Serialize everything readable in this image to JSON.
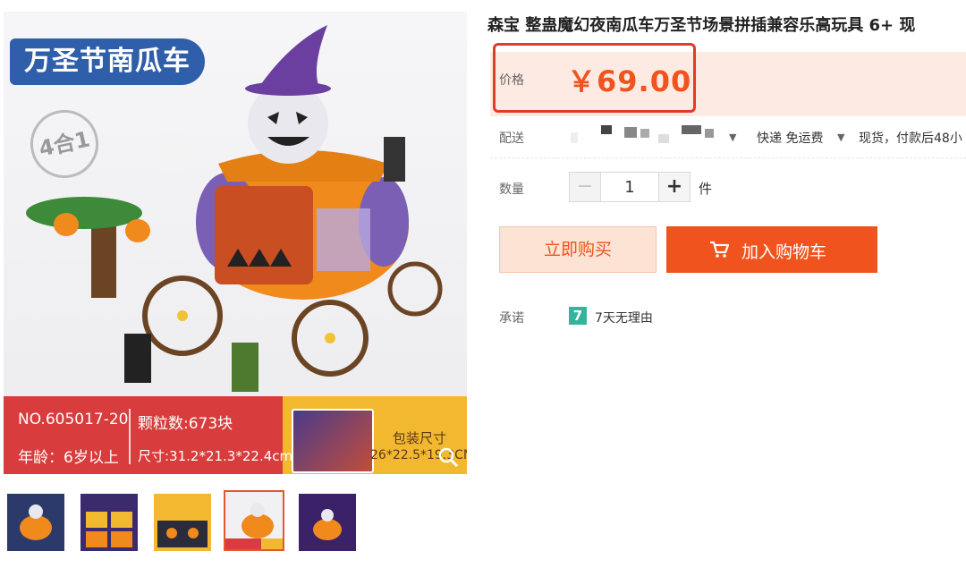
{
  "gallery": {
    "main_image": {
      "badge_title": "万圣节南瓜车",
      "corner_badge": "4合1",
      "info": {
        "model_no": "NO.605017-20",
        "pieces": "颗粒数:673块",
        "age": "年龄：6岁以上",
        "size": "尺寸:31.2*21.3*22.4cm",
        "package_label": "包装尺寸",
        "package_size": "26*22.5*19.3CM"
      },
      "colors": {
        "band_red": "#d83c3c",
        "band_yellow": "#f2b930",
        "badge_blue": "#2f5eaa",
        "pumpkin_orange": "#f08a1c"
      },
      "zoom_icon": "zoom-icon"
    },
    "thumbnails": [
      {
        "name": "thumb-1",
        "active": false
      },
      {
        "name": "thumb-2",
        "active": false
      },
      {
        "name": "thumb-3",
        "active": false
      },
      {
        "name": "thumb-4",
        "active": true
      },
      {
        "name": "thumb-5",
        "active": false
      }
    ]
  },
  "product": {
    "title": "森宝 整蛊魔幻夜南瓜车万圣节场景拼插兼容乐高玩具 6+ 现",
    "price_label": "价格",
    "price": "￥69.00",
    "shipping_label": "配送",
    "shipping_method": "快递 免运费",
    "shipping_note": "现货，付款后48小",
    "quantity_label": "数量",
    "quantity_value": "1",
    "quantity_unit": "件",
    "minus": "−",
    "plus": "+",
    "buy_now": "立即购买",
    "add_to_cart": "加入购物车",
    "promise_label": "承诺",
    "promise_icon_text": "7",
    "promise_text": "7天无理由"
  },
  "colors": {
    "accent": "#f0531e",
    "price_panel_bg": "#fdebe3",
    "highlight_border": "#e23b2b",
    "promise_green": "#36b39d"
  }
}
